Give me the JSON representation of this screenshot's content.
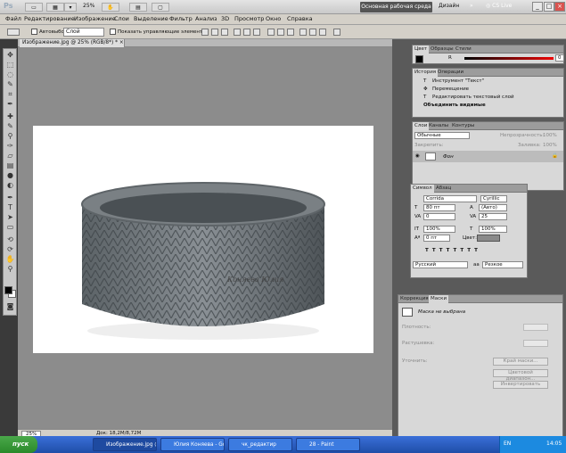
{
  "app": {
    "logo": "Ps",
    "zoom": "25%",
    "workspace": "Основная рабочая среда",
    "design": "Дизайн",
    "cslive": "CS Live"
  },
  "menu": [
    "Файл",
    "Редактирование",
    "Изображение",
    "Слои",
    "Выделение",
    "Фильтр",
    "Анализ",
    "3D",
    "Просмотр",
    "Окно",
    "Справка"
  ],
  "options": {
    "autoselect": "Автовыбор:",
    "layer_select": "Слой",
    "show_controls": "Показать управляющие элементы"
  },
  "document": {
    "tab_title": "Изображение.jpg @ 25% (RGB/8*) *",
    "zoom": "25%",
    "doc_size": "Док: 18,2M/8,72M",
    "watermark": "Коняева Юлия"
  },
  "color_panel": {
    "tabs": [
      "Цвет",
      "Образцы",
      "Стили"
    ],
    "channel": "R",
    "value": "0",
    "fg": "#000000",
    "bg": "#ffffff"
  },
  "history_panel": {
    "tabs": [
      "История",
      "Операции"
    ],
    "items": [
      "Инструмент \"Текст\"",
      "Перемещение",
      "Редактировать текстовый слой",
      "Объединить видимые"
    ]
  },
  "layers_panel": {
    "tabs": [
      "Слои",
      "Каналы",
      "Контуры"
    ],
    "blend": "Обычные",
    "opacity_label": "Непрозрачность:",
    "opacity": "100%",
    "lock_label": "Закрепить:",
    "fill_label": "Заливка:",
    "fill": "100%",
    "layer_name": "Фон"
  },
  "char_panel": {
    "tabs": [
      "Символ",
      "Абзац"
    ],
    "font": "Corrida",
    "script": "Cyrillic",
    "size": "80 пт",
    "leading": "(Авто)",
    "kerning": "0",
    "tracking": "25",
    "vscale": "100%",
    "hscale": "100%",
    "baseline": "0 пт",
    "color_label": "Цвет:",
    "language": "Русский",
    "aa": "Резкое"
  },
  "masks_panel": {
    "tabs": [
      "Коррекция",
      "Маски"
    ],
    "no_mask": "Маска не выбрана",
    "density": "Плотность:",
    "feather": "Растушевка:",
    "refine": "Уточнить:",
    "btn_edge": "Край маски...",
    "btn_color": "Цветовой диапазон...",
    "btn_invert": "Инвертировать"
  },
  "taskbar": {
    "start": "пуск",
    "tasks": [
      "Изображение.jpg @ 2...",
      "Юлия Коняева - Goo...",
      "чк_редактир",
      "28 - Paint"
    ],
    "time": "14:05",
    "lang": "EN"
  }
}
